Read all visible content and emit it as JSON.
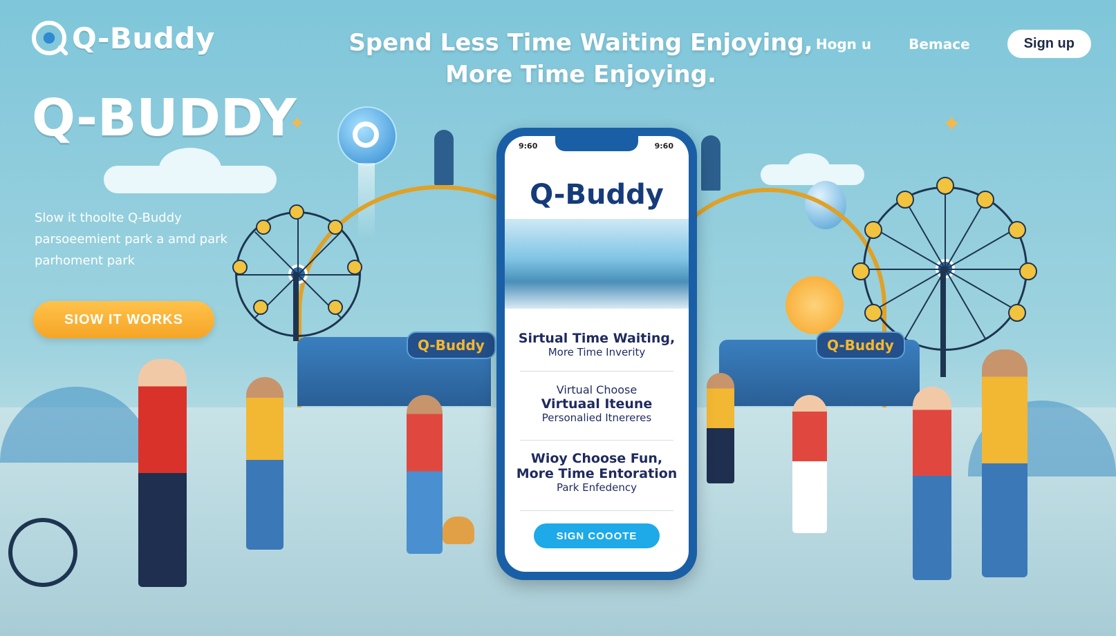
{
  "header": {
    "logo_text": "Q-Buddy",
    "headline_line1": "Spend Less Time Waiting Enjoying,",
    "headline_line2": "More Time Enjoying.",
    "nav": [
      "Hogn u",
      "Bemace"
    ],
    "signup_label": "Sign up"
  },
  "hero": {
    "title": "Q-BUDDY",
    "description_lines": [
      "Slow it thoolte Q-Buddy",
      "parsoeemient park a amd park",
      "parhoment park"
    ],
    "cta_label": "SIOW IT WORKS"
  },
  "phone": {
    "status_left": "9:60",
    "status_right": "9:60",
    "logo": "Q-Buddy",
    "sections": [
      {
        "title": "Sirtual Time Waiting,",
        "subtitle": "More Time Inverity"
      },
      {
        "title": "Virtual Choose",
        "title2": "Virtuaal Iteune",
        "subtitle": "Personalied Itnereres"
      },
      {
        "title": "Wioy Choose Fun,",
        "title2": "More Time Entoration",
        "subtitle": "Park Enfedency"
      }
    ],
    "button_label": "SIGN COOOTE"
  },
  "scene": {
    "booth_sign_left": "Q-Buddy",
    "booth_sign_right": "Q-Buddy"
  },
  "colors": {
    "sky": "#7fc6da",
    "accent_orange": "#f5a526",
    "phone_frame": "#1a5fa6",
    "phone_button": "#1ea9e8"
  }
}
